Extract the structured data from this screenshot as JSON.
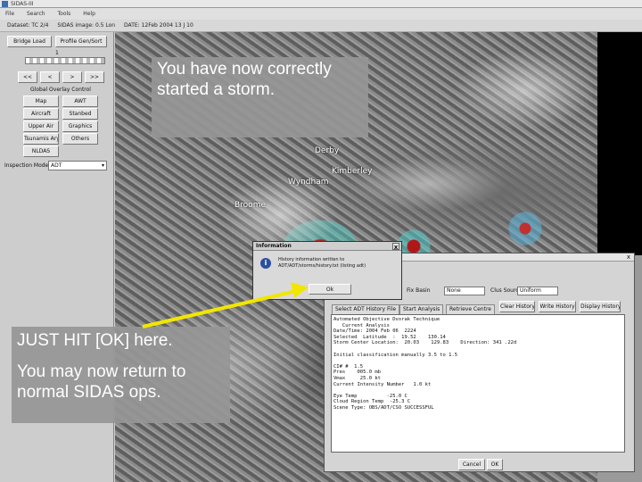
{
  "window": {
    "title": "SIDAS-III"
  },
  "menubar": [
    "File",
    "Search",
    "Tools",
    "Help"
  ],
  "statusbar": [
    "Dataset: TC 2/4",
    "SIDAS image: 0.5 Lon",
    "DATE: 12Feb 2004 13 J 10"
  ],
  "left_panel": {
    "top_buttons": [
      "Bridge Load",
      "Profile Gen/Sort"
    ],
    "step_label": "1",
    "nav_buttons": [
      "<<",
      "<",
      ">",
      ">>"
    ],
    "overlay_group_label": "Global Overlay Control",
    "overlay_buttons": [
      "Map",
      "AWT",
      "Aircraft",
      "Stanbed",
      "Upper Air",
      "Graphics",
      "Tsunamis Ary",
      "Others",
      "NLDAS"
    ],
    "inspect_label": "Inspection Mode",
    "inspect_value": "ADT"
  },
  "map_labels": [
    "Derby",
    "Kimberley",
    "Wyndham",
    "Broome"
  ],
  "callouts": {
    "top": "You have now correctly started a storm.",
    "bottom_1": "JUST HIT [OK] here.",
    "bottom_2": "You may now return to normal SIDAS ops."
  },
  "info_dialog": {
    "title": "Information",
    "close": "x",
    "icon_name": "info-icon",
    "icon_glyph": "i",
    "message_1": "History information written to",
    "message_2": "ADT/ADT/storms/history.txt  (listing adt)",
    "ok_label": "Ok"
  },
  "adt_window": {
    "close": "x",
    "fix_basin_label": "Fix Basin",
    "fix_basin_value": "None",
    "clus_source_label": "Clus Source",
    "clus_source_value": "Uniform",
    "buttons": [
      "Clear History",
      "Write History",
      "Display History"
    ],
    "tabs": [
      "Select ADT History File",
      "Start Analysis",
      "Retrieve Centre"
    ],
    "output_lines": [
      "Automated Objective Dvorak Technique",
      "   Current Analysis",
      "Date/Time: 2004 Feb 06  2224",
      "Selected  Latitude  :  19.52    130.14",
      "Storm Center Location:  20.03    129.83    Direction: 341 .22d",
      "",
      "Initial classification manually 3.5 to 1.5",
      "",
      "CI# #  1.5",
      "Pres    005.0 mb",
      "Vmax     25.0 kt",
      "Current Intensity Number   1.0 kt",
      "",
      "Eye Temp          -25.0 C",
      "Cloud Region Temp  -25.3 C",
      "Scene Type: OBS/ADT/CSO SUCCESSFUL"
    ],
    "cancel_label": "Cancel",
    "ok_label": "OK"
  }
}
